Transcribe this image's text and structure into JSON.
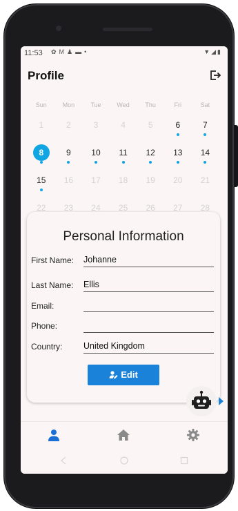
{
  "status_bar": {
    "time": "11:53",
    "notification_icons": [
      "settings-icon",
      "gmail-icon",
      "person-icon",
      "clipboard-icon",
      "dot-icon"
    ],
    "system_icons": [
      "wifi-icon",
      "signal-icon",
      "battery-icon"
    ]
  },
  "header": {
    "title": "Profile",
    "logout_icon": "logout-icon"
  },
  "calendar": {
    "weekdays": [
      "Sun",
      "Mon",
      "Tue",
      "Wed",
      "Thu",
      "Fri",
      "Sat"
    ],
    "weeks": [
      [
        {
          "day": "1",
          "faded": true,
          "dot": false
        },
        {
          "day": "2",
          "faded": true,
          "dot": false
        },
        {
          "day": "3",
          "faded": true,
          "dot": false
        },
        {
          "day": "4",
          "faded": true,
          "dot": false
        },
        {
          "day": "5",
          "faded": true,
          "dot": false
        },
        {
          "day": "6",
          "faded": false,
          "dot": true
        },
        {
          "day": "7",
          "faded": false,
          "dot": true
        }
      ],
      [
        {
          "day": "8",
          "faded": false,
          "dot": true,
          "selected": true
        },
        {
          "day": "9",
          "faded": false,
          "dot": true
        },
        {
          "day": "10",
          "faded": false,
          "dot": true
        },
        {
          "day": "11",
          "faded": false,
          "dot": true
        },
        {
          "day": "12",
          "faded": false,
          "dot": true
        },
        {
          "day": "13",
          "faded": false,
          "dot": true
        },
        {
          "day": "14",
          "faded": false,
          "dot": true
        }
      ],
      [
        {
          "day": "15",
          "faded": false,
          "dot": true
        },
        {
          "day": "16",
          "faded": true,
          "dot": false
        },
        {
          "day": "17",
          "faded": true,
          "dot": false
        },
        {
          "day": "18",
          "faded": true,
          "dot": false
        },
        {
          "day": "19",
          "faded": true,
          "dot": false
        },
        {
          "day": "20",
          "faded": true,
          "dot": false
        },
        {
          "day": "21",
          "faded": true,
          "dot": false
        }
      ],
      [
        {
          "day": "22",
          "faded": true,
          "dot": false
        },
        {
          "day": "23",
          "faded": true,
          "dot": false
        },
        {
          "day": "24",
          "faded": true,
          "dot": false
        },
        {
          "day": "25",
          "faded": true,
          "dot": false
        },
        {
          "day": "26",
          "faded": true,
          "dot": false
        },
        {
          "day": "27",
          "faded": true,
          "dot": false
        },
        {
          "day": "28",
          "faded": true,
          "dot": false
        }
      ]
    ]
  },
  "personal_info": {
    "title": "Personal Information",
    "fields": [
      {
        "label": "First Name:",
        "value": "Johanne"
      },
      {
        "label": "Last Name:",
        "value": "Ellis"
      },
      {
        "label": "Email:",
        "value": ""
      },
      {
        "label": "Phone:",
        "value": ""
      },
      {
        "label": "Country:",
        "value": "United Kingdom"
      }
    ],
    "edit_label": "Edit"
  },
  "assistant": {
    "icon": "robot-icon"
  },
  "bottom_nav": {
    "items": [
      {
        "icon": "person-icon",
        "active": true
      },
      {
        "icon": "home-icon",
        "active": false
      },
      {
        "icon": "gear-icon",
        "active": false
      }
    ]
  },
  "colors": {
    "accent": "#12a5e3",
    "button": "#1a82d9",
    "nav_active": "#1a6fd6",
    "nav_inactive": "#8a8a8a",
    "background": "#fbf6f5"
  }
}
